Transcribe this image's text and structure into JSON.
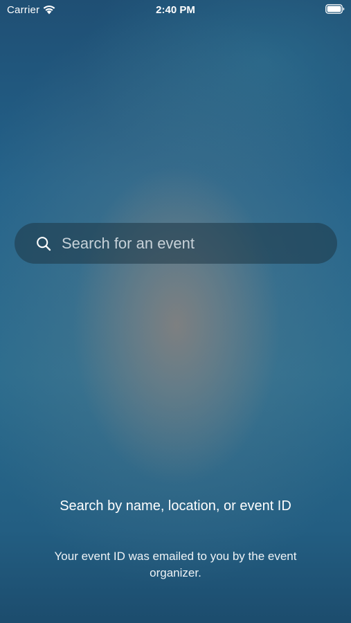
{
  "status_bar": {
    "carrier": "Carrier",
    "time": "2:40 PM",
    "wifi_icon": "wifi-icon",
    "battery_icon": "battery-icon"
  },
  "search": {
    "icon": "search-icon",
    "placeholder": "Search for an event",
    "value": ""
  },
  "hints": {
    "primary": "Search by name, location, or event ID",
    "secondary": "Your event ID was emailed to you by the event organizer."
  },
  "colors": {
    "text": "#ffffff",
    "background_top": "#1f4f74",
    "background_center": "#808080",
    "search_bar_bg": "rgba(30,55,70,0.55)"
  }
}
